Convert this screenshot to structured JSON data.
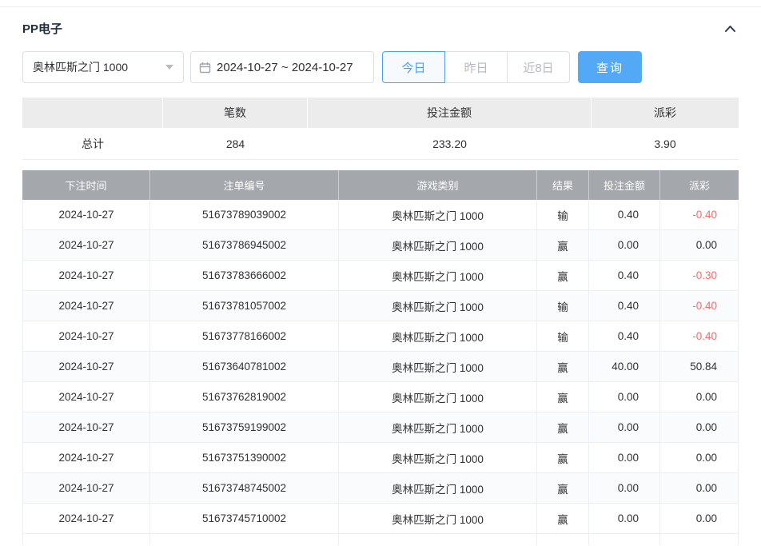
{
  "header": {
    "title": "PP电子"
  },
  "filters": {
    "game_select_value": "奥林匹斯之门 1000",
    "date_range_value": "2024-10-27 ~ 2024-10-27",
    "quick_ranges": [
      {
        "label": "今日",
        "active": true
      },
      {
        "label": "昨日",
        "active": false
      },
      {
        "label": "近8日",
        "active": false
      }
    ],
    "search_label": "查询"
  },
  "summary": {
    "headers": [
      "笔数",
      "投注金额",
      "派彩"
    ],
    "total_label": "总计",
    "count": "284",
    "bet_amount": "233.20",
    "payout": "3.90"
  },
  "table": {
    "headers": [
      "下注时间",
      "注单编号",
      "游戏类别",
      "结果",
      "投注金额",
      "派彩"
    ],
    "rows": [
      {
        "date": "2024-10-27",
        "order_id": "51673789039002",
        "game": "奥林匹斯之门 1000",
        "result": "输",
        "bet": "0.40",
        "payout": "-0.40"
      },
      {
        "date": "2024-10-27",
        "order_id": "51673786945002",
        "game": "奥林匹斯之门 1000",
        "result": "赢",
        "bet": "0.00",
        "payout": "0.00"
      },
      {
        "date": "2024-10-27",
        "order_id": "51673783666002",
        "game": "奥林匹斯之门 1000",
        "result": "赢",
        "bet": "0.40",
        "payout": "-0.30"
      },
      {
        "date": "2024-10-27",
        "order_id": "51673781057002",
        "game": "奥林匹斯之门 1000",
        "result": "输",
        "bet": "0.40",
        "payout": "-0.40"
      },
      {
        "date": "2024-10-27",
        "order_id": "51673778166002",
        "game": "奥林匹斯之门 1000",
        "result": "输",
        "bet": "0.40",
        "payout": "-0.40"
      },
      {
        "date": "2024-10-27",
        "order_id": "51673640781002",
        "game": "奥林匹斯之门 1000",
        "result": "赢",
        "bet": "40.00",
        "payout": "50.84"
      },
      {
        "date": "2024-10-27",
        "order_id": "51673762819002",
        "game": "奥林匹斯之门 1000",
        "result": "赢",
        "bet": "0.00",
        "payout": "0.00"
      },
      {
        "date": "2024-10-27",
        "order_id": "51673759199002",
        "game": "奥林匹斯之门 1000",
        "result": "赢",
        "bet": "0.00",
        "payout": "0.00"
      },
      {
        "date": "2024-10-27",
        "order_id": "51673751390002",
        "game": "奥林匹斯之门 1000",
        "result": "赢",
        "bet": "0.00",
        "payout": "0.00"
      },
      {
        "date": "2024-10-27",
        "order_id": "51673748745002",
        "game": "奥林匹斯之门 1000",
        "result": "赢",
        "bet": "0.00",
        "payout": "0.00"
      },
      {
        "date": "2024-10-27",
        "order_id": "51673745710002",
        "game": "奥林匹斯之门 1000",
        "result": "赢",
        "bet": "0.00",
        "payout": "0.00"
      }
    ]
  },
  "colors": {
    "accent_blue": "#54a9f7",
    "active_range_blue": "#4da0f5",
    "negative_red": "#f56c6c",
    "table_header_gray": "#a4a7ab"
  },
  "icons": {
    "collapse": "chevron-up-icon",
    "select_caret": "caret-down-icon",
    "date": "calendar-icon"
  }
}
